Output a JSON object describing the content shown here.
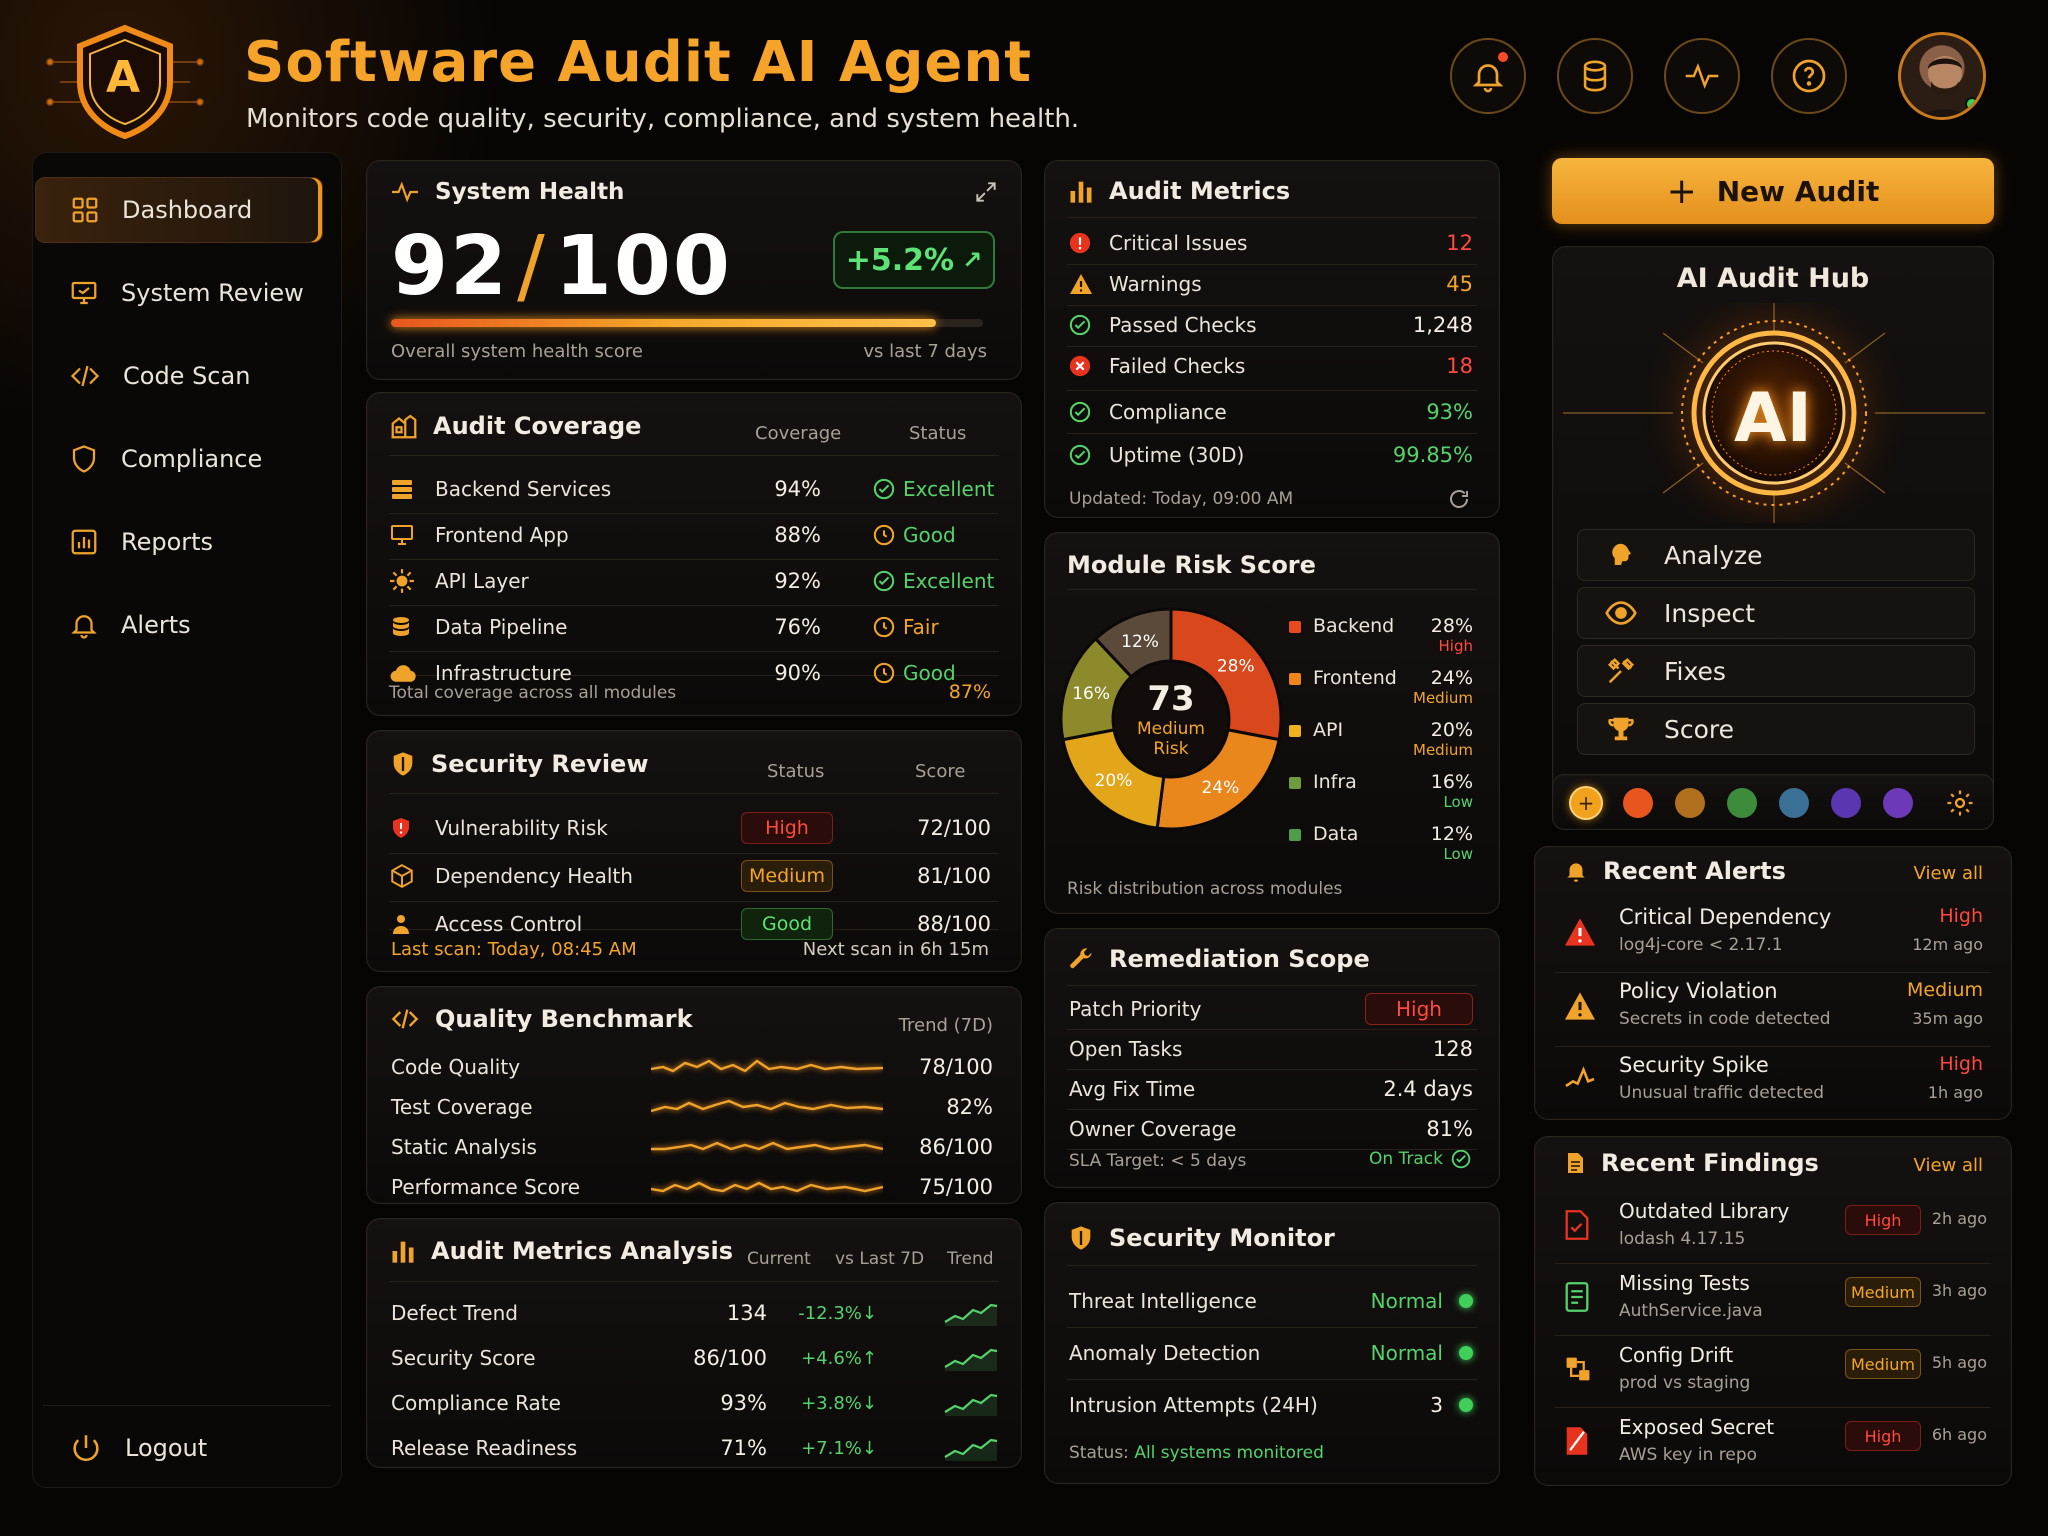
{
  "header": {
    "title": "Software Audit AI Agent",
    "subtitle": "Monitors code quality, security, compliance, and system health.",
    "logo_letter": "A",
    "icons": [
      "bell-icon",
      "database-icon",
      "pulse-icon",
      "help-icon"
    ]
  },
  "sidebar": {
    "items": [
      {
        "label": "Dashboard",
        "icon": "grid-icon"
      },
      {
        "label": "System Review",
        "icon": "monitor-icon"
      },
      {
        "label": "Code Scan",
        "icon": "code-icon"
      },
      {
        "label": "Compliance",
        "icon": "shield-icon"
      },
      {
        "label": "Reports",
        "icon": "chart-icon"
      },
      {
        "label": "Alerts",
        "icon": "bell-icon"
      }
    ],
    "logout": "Logout"
  },
  "system_health": {
    "title": "System Health",
    "score": "92",
    "max": "100",
    "change": "+5.2%",
    "progress": 0.92,
    "caption": "Overall system health score",
    "compare": "vs last 7 days"
  },
  "coverage": {
    "title": "Audit Coverage",
    "col_coverage": "Coverage",
    "col_status": "Status",
    "rows": [
      {
        "name": "Backend Services",
        "value": "94%",
        "status": "Excellent"
      },
      {
        "name": "Frontend App",
        "value": "88%",
        "status": "Good"
      },
      {
        "name": "API Layer",
        "value": "92%",
        "status": "Excellent"
      },
      {
        "name": "Data Pipeline",
        "value": "76%",
        "status": "Fair"
      },
      {
        "name": "Infrastructure",
        "value": "90%",
        "status": "Good"
      }
    ],
    "total_label": "Total coverage across all modules",
    "total_value": "87%"
  },
  "security_review": {
    "title": "Security Review",
    "col_status": "Status",
    "col_score": "Score",
    "rows": [
      {
        "name": "Vulnerability Risk",
        "status": "High",
        "score": "72/100"
      },
      {
        "name": "Dependency Health",
        "status": "Medium",
        "score": "81/100"
      },
      {
        "name": "Access Control",
        "status": "Good",
        "score": "88/100"
      }
    ],
    "last_scan": "Last scan: Today, 08:45 AM",
    "next_scan": "Next scan in 6h 15m"
  },
  "quality": {
    "title": "Quality Benchmark",
    "trend_label": "Trend (7D)",
    "rows": [
      {
        "name": "Code Quality",
        "value": "78/100"
      },
      {
        "name": "Test Coverage",
        "value": "82%"
      },
      {
        "name": "Static Analysis",
        "value": "86/100"
      },
      {
        "name": "Performance Score",
        "value": "75/100"
      }
    ]
  },
  "analysis": {
    "title": "Audit Metrics Analysis",
    "col_current": "Current",
    "col_vs": "vs Last 7D",
    "col_trend": "Trend",
    "rows": [
      {
        "name": "Defect Trend",
        "current": "134",
        "change": "-12.3%↓"
      },
      {
        "name": "Security Score",
        "current": "86/100",
        "change": "+4.6%↑"
      },
      {
        "name": "Compliance Rate",
        "current": "93%",
        "change": "+3.8%↓"
      },
      {
        "name": "Release Readiness",
        "current": "71%",
        "change": "+7.1%↓"
      }
    ]
  },
  "audit_metrics": {
    "title": "Audit Metrics",
    "rows": [
      {
        "name": "Critical Issues",
        "value": "12"
      },
      {
        "name": "Warnings",
        "value": "45"
      },
      {
        "name": "Passed Checks",
        "value": "1,248"
      },
      {
        "name": "Failed Checks",
        "value": "18"
      },
      {
        "name": "Compliance",
        "value": "93%"
      },
      {
        "name": "Uptime (30D)",
        "value": "99.85%"
      }
    ],
    "updated": "Updated: Today, 09:00 AM"
  },
  "module_risk": {
    "title": "Module Risk Score",
    "center_value": "73",
    "center_label1": "Medium",
    "center_label2": "Risk",
    "caption": "Risk distribution across modules",
    "legend": [
      {
        "name": "Backend",
        "pct": "28%",
        "level": "High",
        "color": "#e84a1f"
      },
      {
        "name": "Frontend",
        "pct": "24%",
        "level": "Medium",
        "color": "#ef8419"
      },
      {
        "name": "API",
        "pct": "20%",
        "level": "Medium",
        "color": "#f0b21c"
      },
      {
        "name": "Infra",
        "pct": "16%",
        "level": "Low",
        "color": "#6f9b3c"
      },
      {
        "name": "Data",
        "pct": "12%",
        "level": "Low",
        "color": "#4f9d48"
      }
    ]
  },
  "chart_data": {
    "type": "pie",
    "categories": [
      "Backend",
      "Frontend",
      "API",
      "Infra",
      "Data"
    ],
    "values": [
      28,
      24,
      20,
      16,
      12
    ],
    "title": "Module Risk Score"
  },
  "remediation": {
    "title": "Remediation Scope",
    "rows": [
      {
        "name": "Patch Priority",
        "value": "High"
      },
      {
        "name": "Open Tasks",
        "value": "128"
      },
      {
        "name": "Avg Fix Time",
        "value": "2.4 days"
      },
      {
        "name": "Owner Coverage",
        "value": "81%"
      }
    ],
    "sla": "SLA Target: < 5 days",
    "sla_status": "On Track"
  },
  "security_monitor": {
    "title": "Security Monitor",
    "rows": [
      {
        "name": "Threat Intelligence",
        "value": "Normal"
      },
      {
        "name": "Anomaly Detection",
        "value": "Normal"
      },
      {
        "name": "Intrusion Attempts (24H)",
        "value": "3"
      }
    ],
    "status_label": "Status:",
    "status_value": "All systems monitored"
  },
  "new_audit": {
    "label": "New Audit"
  },
  "hub": {
    "title": "AI Audit Hub",
    "core": "AI",
    "buttons": [
      {
        "label": "Analyze",
        "icon": "brain-icon"
      },
      {
        "label": "Inspect",
        "icon": "eye-icon"
      },
      {
        "label": "Fixes",
        "icon": "tools-icon"
      },
      {
        "label": "Score",
        "icon": "trophy-icon"
      }
    ],
    "swatches": [
      "#f0a21c",
      "#e8551e",
      "#b0701e",
      "#3d8c3b",
      "#3a6f96",
      "#5a36b0",
      "#6c3ab8"
    ]
  },
  "alerts": {
    "title": "Recent Alerts",
    "view_all": "View all",
    "items": [
      {
        "title": "Critical Dependency",
        "sub": "log4j-core < 2.17.1",
        "level": "High",
        "time": "12m ago"
      },
      {
        "title": "Policy Violation",
        "sub": "Secrets in code detected",
        "level": "Medium",
        "time": "35m ago"
      },
      {
        "title": "Security Spike",
        "sub": "Unusual traffic detected",
        "level": "High",
        "time": "1h ago"
      }
    ]
  },
  "findings": {
    "title": "Recent Findings",
    "view_all": "View all",
    "items": [
      {
        "title": "Outdated Library",
        "sub": "lodash 4.17.15",
        "level": "High",
        "time": "2h ago"
      },
      {
        "title": "Missing Tests",
        "sub": "AuthService.java",
        "level": "Medium",
        "time": "3h ago"
      },
      {
        "title": "Config Drift",
        "sub": "prod vs staging",
        "level": "Medium",
        "time": "5h ago"
      },
      {
        "title": "Exposed Secret",
        "sub": "AWS key in repo",
        "level": "High",
        "time": "6h ago"
      }
    ]
  }
}
